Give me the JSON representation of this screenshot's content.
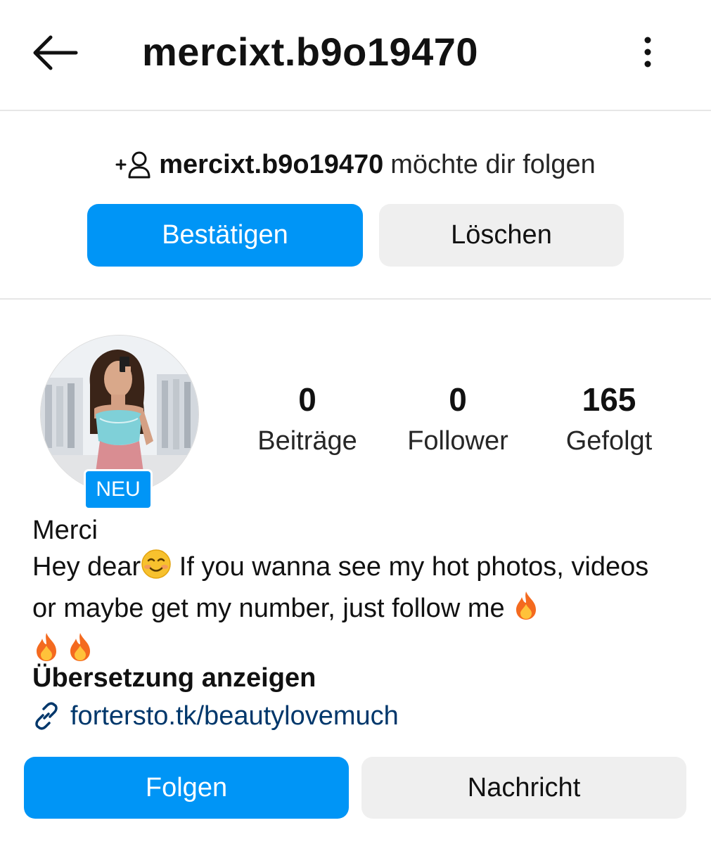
{
  "header": {
    "back_icon": "arrow-left-icon",
    "title": "mercixt.b9o19470",
    "more_icon": "more-vertical-icon"
  },
  "follow_request": {
    "icon": "add-person-icon",
    "username": "mercixt.b9o19470",
    "text": "möchte dir folgen",
    "confirm_label": "Bestätigen",
    "delete_label": "Löschen"
  },
  "profile": {
    "badge": "NEU",
    "stats": {
      "posts_value": "0",
      "posts_label": "Beiträge",
      "followers_value": "0",
      "followers_label": "Follower",
      "following_value": "165",
      "following_label": "Gefolgt"
    },
    "display_name": "Merci",
    "bio_part1": "Hey dear",
    "bio_part2": " If you wanna see my hot photos, videos or maybe get my number, just follow me ",
    "translate_label": "Übersetzung anzeigen",
    "link_icon": "link-icon",
    "link_text": "fortersto.tk/beautylovemuch",
    "follow_label": "Folgen",
    "message_label": "Nachricht"
  },
  "colors": {
    "primary": "#0095f6",
    "secondary_bg": "#efefef",
    "link": "#00376b",
    "divider": "#e6e6e6"
  }
}
